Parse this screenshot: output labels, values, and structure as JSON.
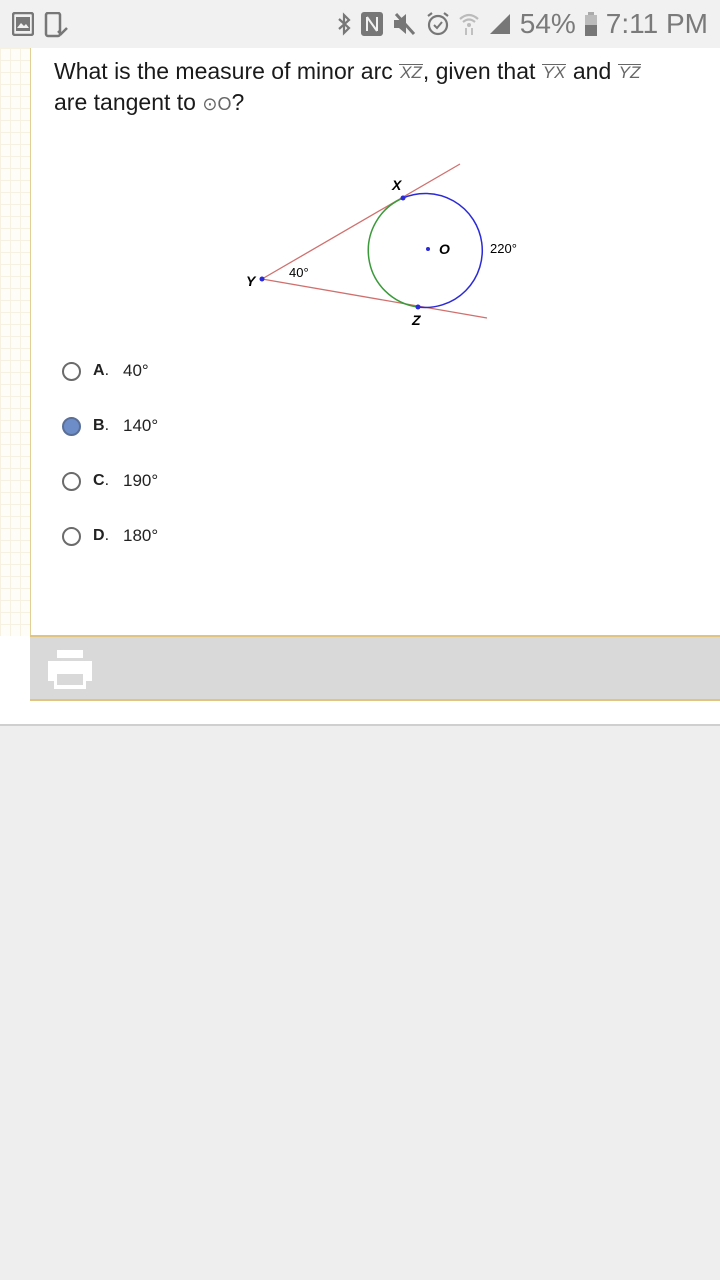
{
  "status_bar": {
    "left_icons": [
      "gallery-icon",
      "phone-check-icon"
    ],
    "right_icons": [
      "bluetooth-icon",
      "nfc-icon",
      "mute-icon",
      "alarm-icon",
      "wifi-icon",
      "signal-icon",
      "battery-icon"
    ],
    "battery": "54%",
    "time": "7:11 PM"
  },
  "question": {
    "part1": "What is the measure of minor arc ",
    "arc_xz": "XZ",
    "part2": ", given that ",
    "seg_yx": "YX",
    "part3": " and ",
    "seg_yz": "YZ",
    "part4": " are tangent to ",
    "circle_symbol": "⊙",
    "circle_name": "O",
    "part5": "?"
  },
  "diagram": {
    "label_x": "X",
    "label_y": "Y",
    "label_z": "Z",
    "label_o": "O",
    "angle_label": "40°",
    "arc_label": "220°",
    "colors": {
      "tangent": "#d0706e",
      "major_arc": "#2a2ad8",
      "minor_arc": "#3a9a3a",
      "points": "#2a2ad8"
    }
  },
  "options": [
    {
      "letter": "A",
      "value": "40°",
      "selected": false
    },
    {
      "letter": "B",
      "value": "140°",
      "selected": true
    },
    {
      "letter": "C",
      "value": "190°",
      "selected": false
    },
    {
      "letter": "D",
      "value": "180°",
      "selected": false
    }
  ],
  "toolbar": {
    "print_icon": "printer-icon"
  }
}
